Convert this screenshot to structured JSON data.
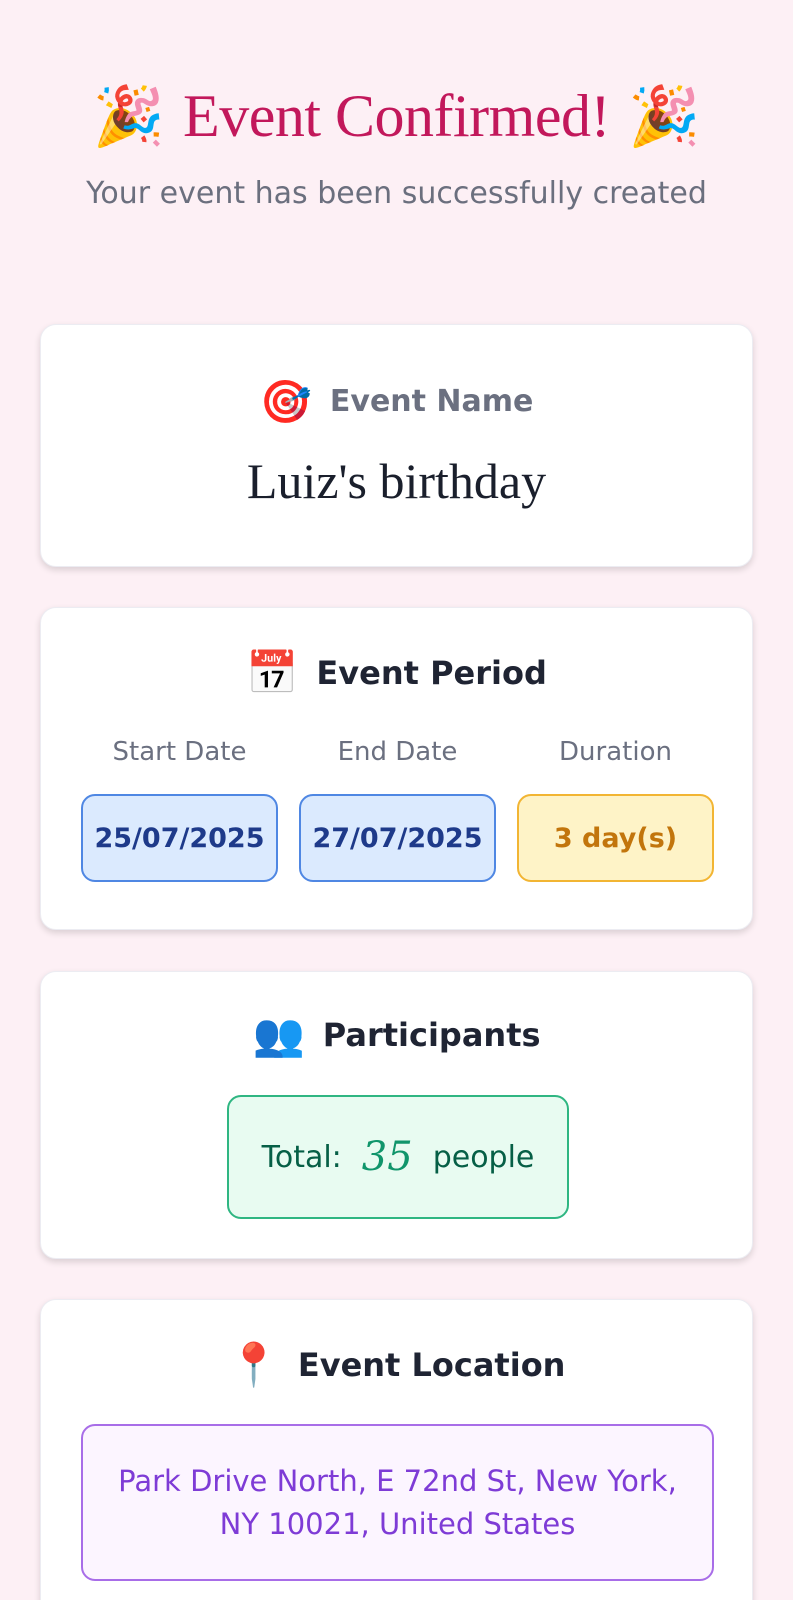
{
  "header": {
    "title": "Event Confirmed!",
    "emoji_left": "🎉",
    "emoji_right": "🎉",
    "subtitle": "Your event has been successfully created"
  },
  "name_card": {
    "icon": "🎯",
    "icon_name": "target-icon",
    "label": "Event Name",
    "value": "Luiz's birthday"
  },
  "period_card": {
    "icon": "📅",
    "icon_name": "calendar-icon",
    "title": "Event Period",
    "start_label": "Start Date",
    "start_value": "25/07/2025",
    "end_label": "End Date",
    "end_value": "27/07/2025",
    "duration_label": "Duration",
    "duration_value": "3 day(s)"
  },
  "participants_card": {
    "icon": "👥",
    "icon_name": "people-icon",
    "title": "Participants",
    "total_label": "Total:",
    "total_value": "35",
    "unit": "people"
  },
  "location_card": {
    "icon": "📍",
    "icon_name": "location-pin-icon",
    "title": "Event Location",
    "address": "Park Drive North, E 72nd St, New York, NY 10021, United States"
  },
  "colors": {
    "background": "#fdf0f5",
    "title": "#c2185b",
    "date_pill": "#dbeafe",
    "duration_pill": "#fef3c7",
    "participants_box": "#e8fbf1",
    "location_box": "#fcf5ff"
  }
}
